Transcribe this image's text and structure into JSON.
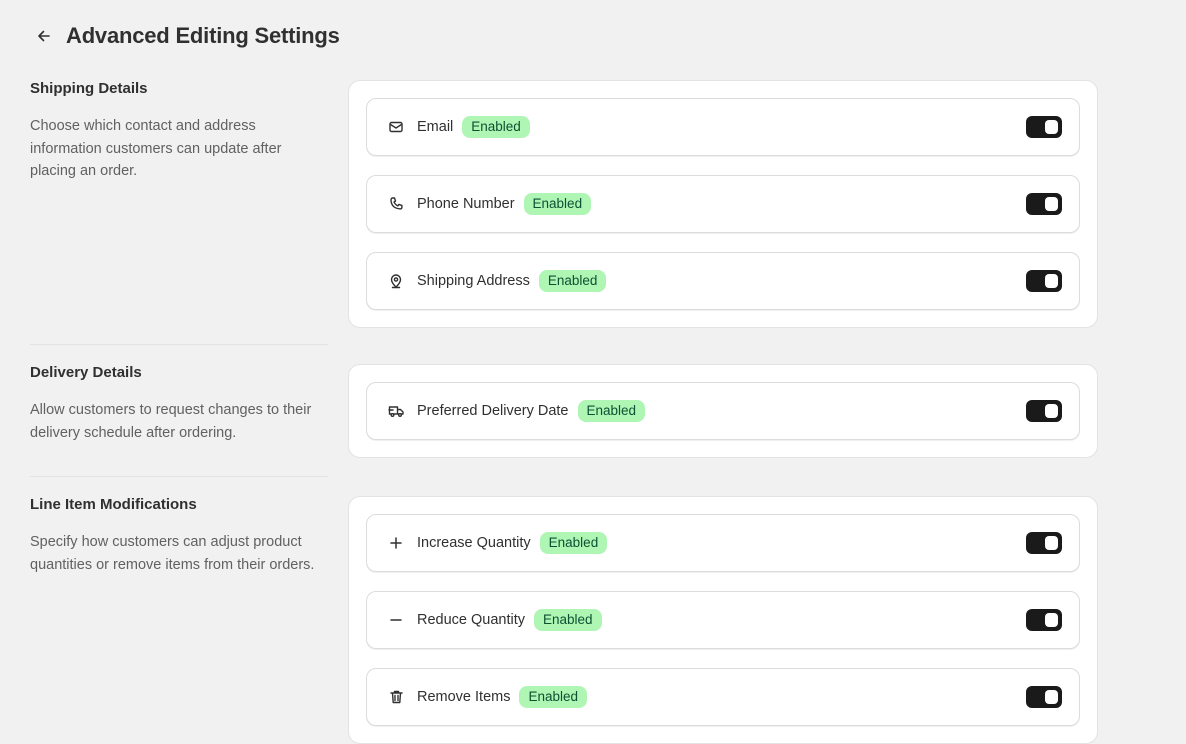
{
  "header": {
    "title": "Advanced Editing Settings",
    "back_icon": "arrow-left-icon"
  },
  "colors": {
    "badge_bg": "#aff5b4",
    "badge_text": "#0c5132",
    "toggle_on": "#1a1a1a"
  },
  "sections": [
    {
      "heading": "Shipping Details",
      "description": "Choose which contact and address information customers can update after placing an order.",
      "items": [
        {
          "label": "Email",
          "badge": "Enabled",
          "icon": "mail-icon",
          "enabled": true
        },
        {
          "label": "Phone Number",
          "badge": "Enabled",
          "icon": "phone-icon",
          "enabled": true
        },
        {
          "label": "Shipping Address",
          "badge": "Enabled",
          "icon": "location-pin-icon",
          "enabled": true
        }
      ]
    },
    {
      "heading": "Delivery Details",
      "description": "Allow customers to request changes to their delivery schedule after ordering.",
      "items": [
        {
          "label": "Preferred Delivery Date",
          "badge": "Enabled",
          "icon": "delivery-truck-icon",
          "enabled": true
        }
      ]
    },
    {
      "heading": "Line Item Modifications",
      "description": "Specify how customers can adjust product quantities or remove items from their orders.",
      "items": [
        {
          "label": "Increase Quantity",
          "badge": "Enabled",
          "icon": "plus-icon",
          "enabled": true
        },
        {
          "label": "Reduce Quantity",
          "badge": "Enabled",
          "icon": "minus-icon",
          "enabled": true
        },
        {
          "label": "Remove Items",
          "badge": "Enabled",
          "icon": "trash-icon",
          "enabled": true
        }
      ]
    }
  ]
}
